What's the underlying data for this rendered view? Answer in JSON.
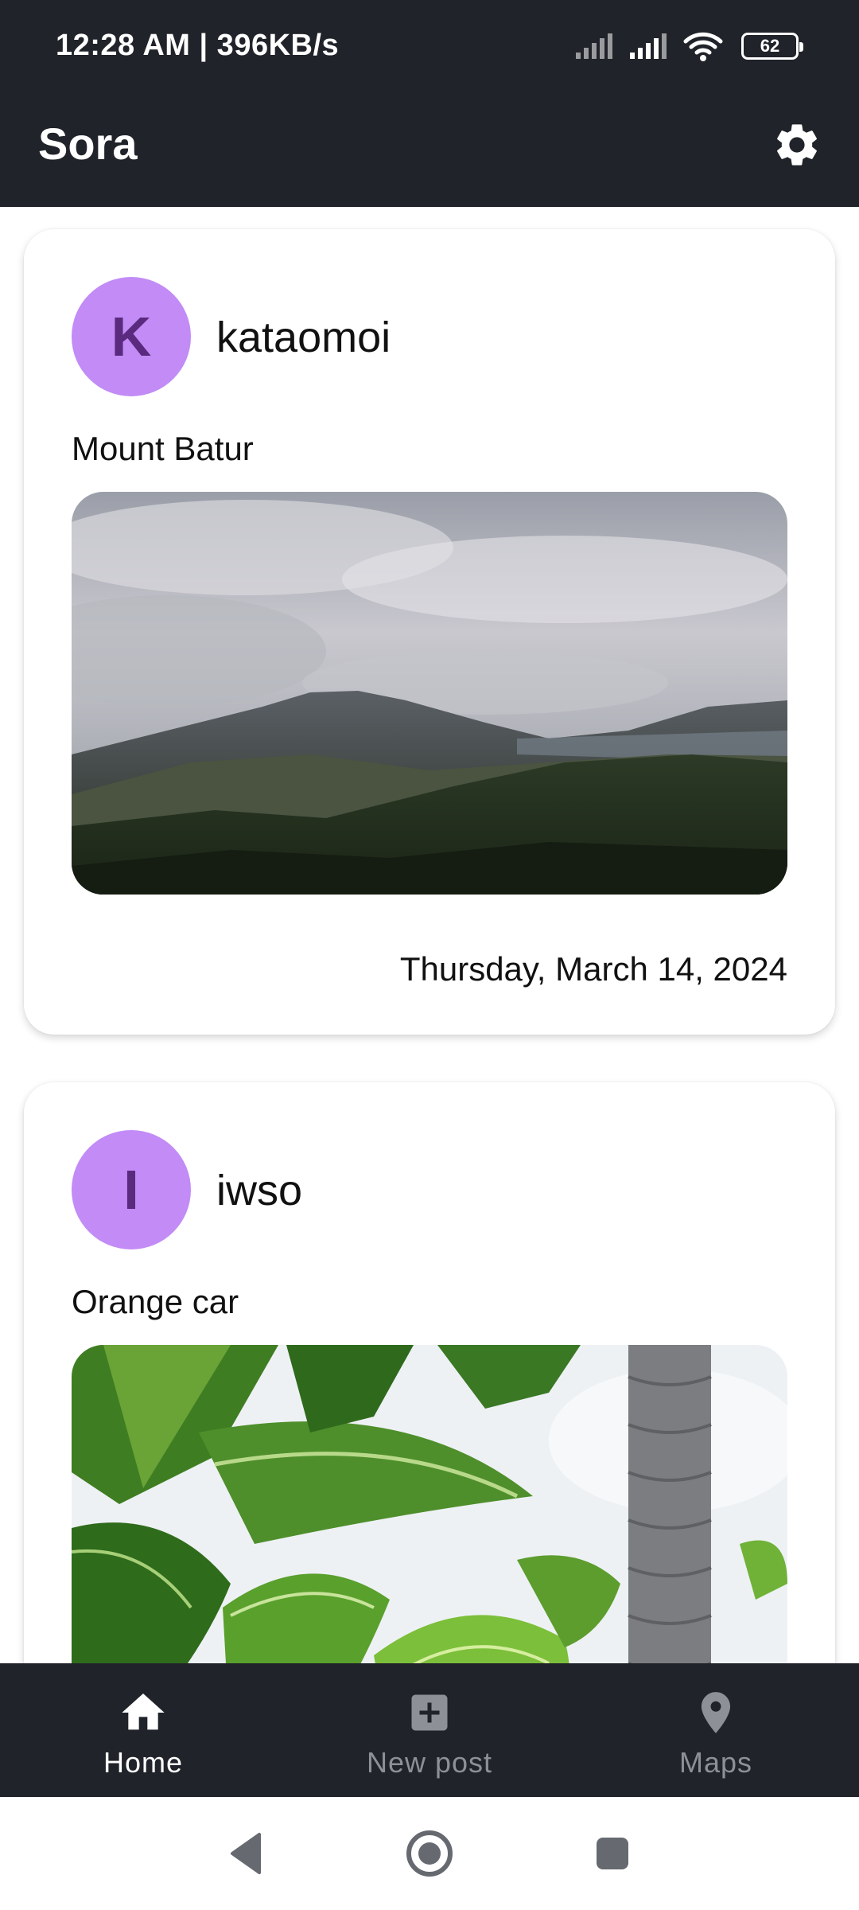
{
  "status_bar": {
    "time": "12:28 AM | 396KB/s",
    "battery": "62",
    "icons": [
      "signal-icon",
      "signal-icon",
      "wifi-icon",
      "battery-icon"
    ]
  },
  "app_bar": {
    "title": "Sora",
    "settings_icon": "gear-icon"
  },
  "posts": [
    {
      "avatar_initial": "K",
      "username": "kataomoi",
      "text": "Mount Batur",
      "date": "Thursday, March 14, 2024",
      "image": "volcano-landscape"
    },
    {
      "avatar_initial": "I",
      "username": "iwso",
      "text": "Orange car",
      "image": "banana-leaves"
    }
  ],
  "bottom_nav": {
    "items": [
      {
        "label": "Home",
        "icon": "home-icon",
        "active": true
      },
      {
        "label": "New post",
        "icon": "add-box-icon",
        "active": false
      },
      {
        "label": "Maps",
        "icon": "location-pin-icon",
        "active": false
      }
    ]
  },
  "system_nav": {
    "icons": [
      "back-icon",
      "home-circle-icon",
      "recents-icon"
    ]
  },
  "colors": {
    "bar_background": "#202329",
    "avatar_background": "#c28bf6",
    "avatar_text": "#5a2a7e",
    "nav_active": "#ffffff",
    "nav_inactive": "#8d9096"
  }
}
